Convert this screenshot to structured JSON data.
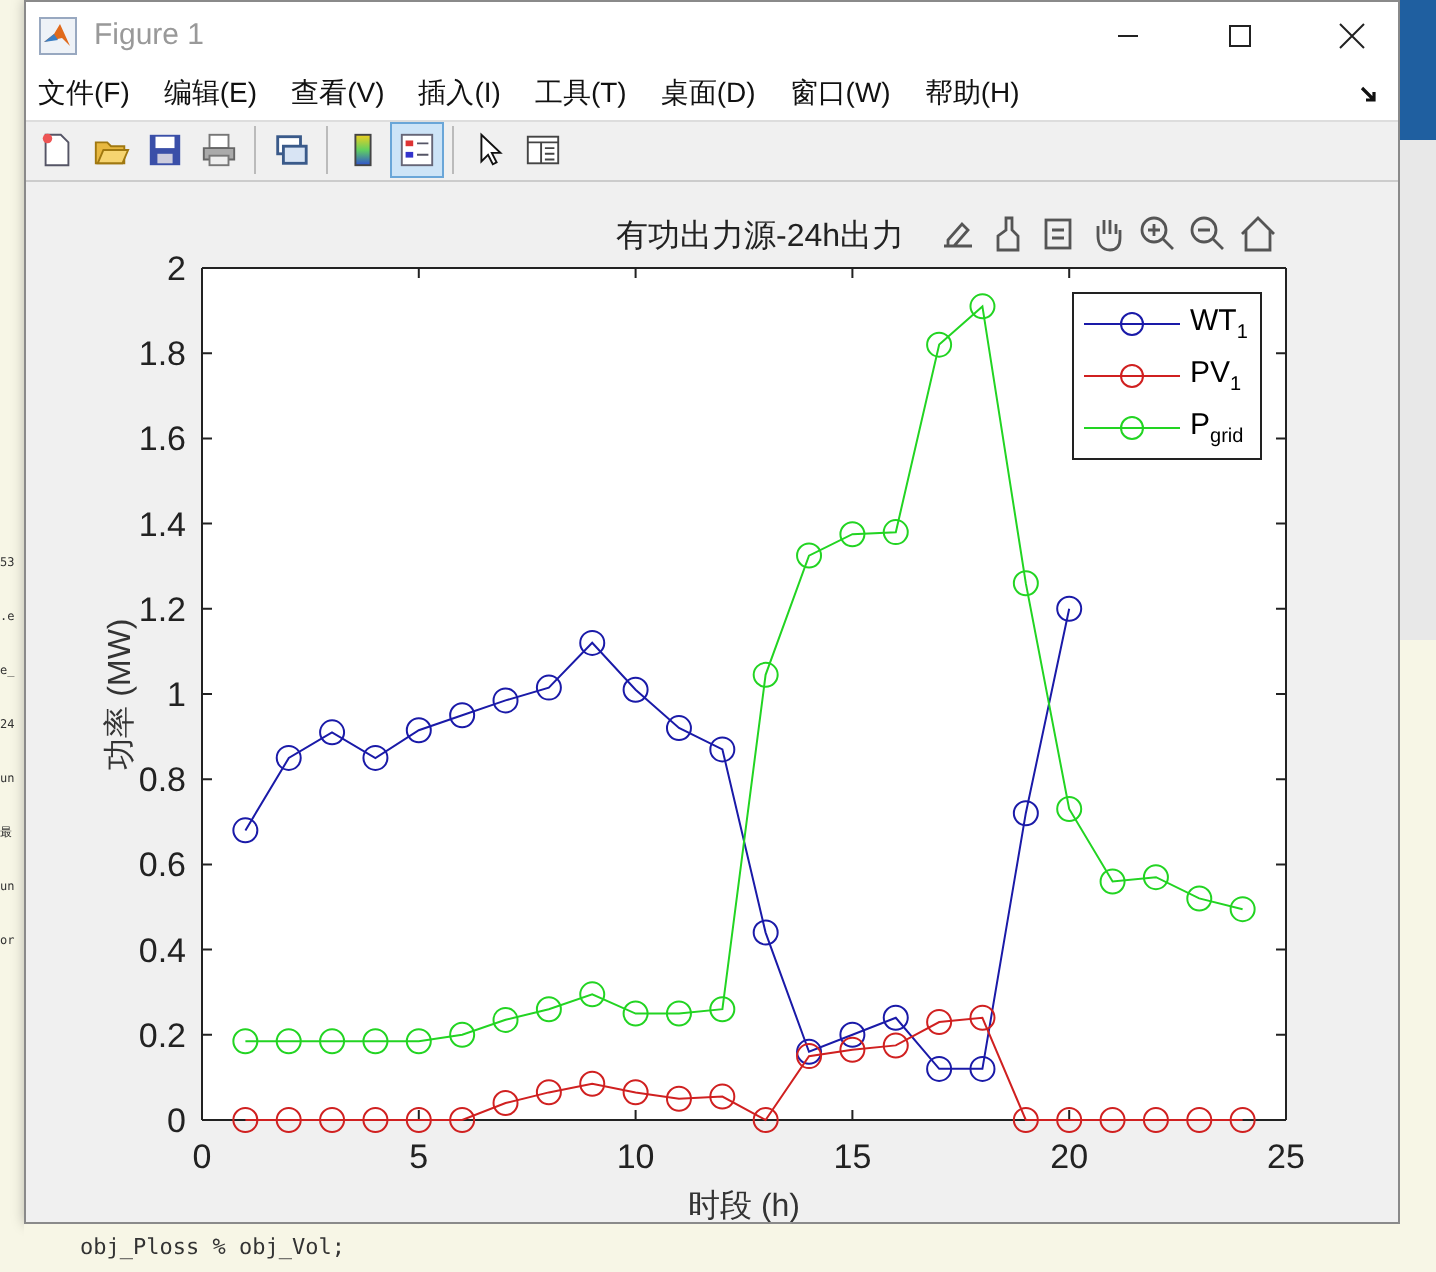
{
  "background": {
    "editor_fragments": [
      "53",
      ".e",
      "e_",
      "24",
      "un",
      "最",
      "un",
      "or"
    ],
    "bottom_line": "obj_Ploss % obj_Vol;"
  },
  "window": {
    "title": "Figure 1"
  },
  "menu": [
    "文件(F)",
    "编辑(E)",
    "查看(V)",
    "插入(I)",
    "工具(T)",
    "桌面(D)",
    "窗口(W)",
    "帮助(H)"
  ],
  "toolbar": [
    {
      "kind": "new",
      "selected": false
    },
    {
      "kind": "open",
      "selected": false
    },
    {
      "kind": "save",
      "selected": false
    },
    {
      "kind": "print",
      "selected": false
    },
    {
      "kind": "link",
      "selected": false
    },
    {
      "kind": "colorbar",
      "selected": false
    },
    {
      "kind": "legend",
      "selected": true
    },
    {
      "kind": "pointer",
      "selected": false
    },
    {
      "kind": "inspector",
      "selected": false
    }
  ],
  "figure": {
    "axes_toolbar": [
      {
        "kind": "export"
      },
      {
        "kind": "brush"
      },
      {
        "kind": "datatip"
      },
      {
        "kind": "pan"
      },
      {
        "kind": "zoom-in"
      },
      {
        "kind": "zoom-out"
      },
      {
        "kind": "home"
      }
    ],
    "chart_data": {
      "type": "line",
      "title": "有功出力源-24h出力",
      "xlabel": "时段 (h)",
      "ylabel": "功率 (MW)",
      "x": [
        1,
        2,
        3,
        4,
        5,
        6,
        7,
        8,
        9,
        10,
        11,
        12,
        13,
        14,
        15,
        16,
        17,
        18,
        19,
        20,
        21,
        22,
        23,
        24
      ],
      "series": [
        {
          "name": "WT$_{1}$",
          "color": "#1a1aa8",
          "marker": "o",
          "values": [
            0.68,
            0.85,
            0.91,
            0.85,
            0.915,
            0.95,
            0.985,
            1.015,
            1.12,
            1.01,
            0.92,
            0.87,
            0.44,
            0.16,
            0.2,
            0.24,
            0.12,
            0.12,
            0.72,
            1.2,
            null,
            null,
            null,
            null
          ]
        },
        {
          "name": "PV$_{1}$",
          "color": "#d02020",
          "marker": "o",
          "values": [
            0,
            0,
            0,
            0,
            0,
            0,
            0.04,
            0.065,
            0.085,
            0.065,
            0.05,
            0.055,
            0,
            0.15,
            0.165,
            0.175,
            0.23,
            0.24,
            0,
            0,
            0,
            0,
            0,
            0
          ]
        },
        {
          "name": "P$_{grid}$",
          "color": "#22d422",
          "marker": "o",
          "values": [
            0.185,
            0.185,
            0.185,
            0.185,
            0.185,
            0.2,
            0.235,
            0.26,
            0.295,
            0.25,
            0.25,
            0.26,
            1.045,
            1.325,
            1.375,
            1.38,
            1.82,
            1.91,
            1.26,
            0.73,
            0.56,
            0.57,
            0.52,
            0.495
          ]
        }
      ],
      "xlim": [
        0,
        25
      ],
      "ylim": [
        0,
        2
      ],
      "xticks": [
        0,
        5,
        10,
        15,
        20,
        25
      ],
      "yticks": [
        0,
        0.2,
        0.4,
        0.6,
        0.8,
        1,
        1.2,
        1.4,
        1.6,
        1.8,
        2
      ]
    }
  }
}
